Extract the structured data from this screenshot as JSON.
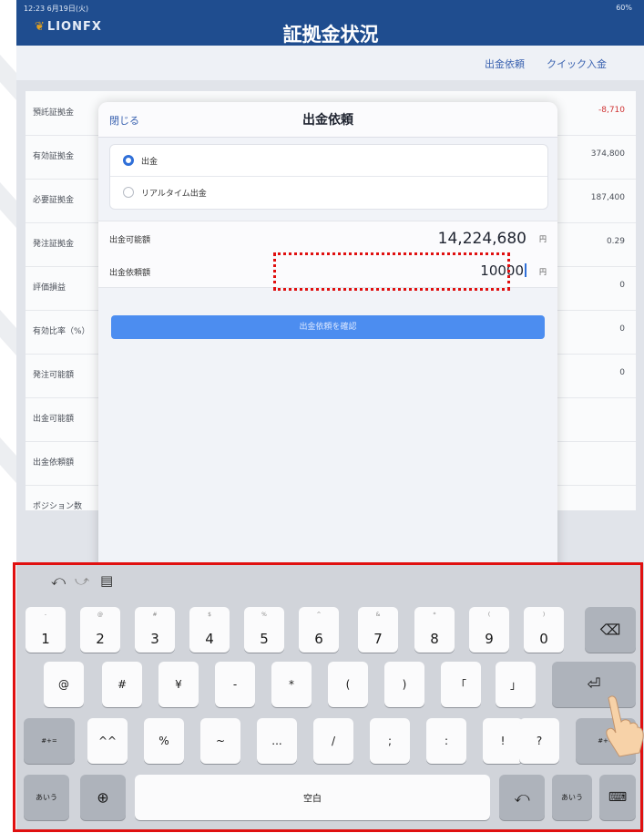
{
  "status": {
    "left": "12:23 6月19日(火)",
    "right": "60%"
  },
  "header": {
    "logo": "LIONFX",
    "title": "証拠金状況"
  },
  "subbar": {
    "withdraw_request": "出金依頼",
    "quick_deposit": "クイック入金"
  },
  "background_list": {
    "rows": [
      {
        "label": "預託証拠金",
        "value": "-8,710",
        "negative": true
      },
      {
        "label": "有効証拠金",
        "value": "374,800"
      },
      {
        "label": "必要証拠金",
        "value": "187,400"
      },
      {
        "label": "発注証拠金",
        "value": "0.29"
      },
      {
        "label": "評価損益",
        "value": "0"
      },
      {
        "label": "有効比率（%）",
        "value": "0"
      },
      {
        "label": "発注可能額",
        "value": "0"
      },
      {
        "label": "出金可能額",
        "value": ""
      },
      {
        "label": "出金依頼額",
        "value": ""
      },
      {
        "label": "ポジション数",
        "value": ""
      }
    ]
  },
  "modal": {
    "close": "閉じる",
    "title": "出金依頼",
    "options": [
      {
        "label": "出金",
        "selected": true
      },
      {
        "label": "リアルタイム出金",
        "selected": false
      }
    ],
    "available_label": "出金可能額",
    "available_value": "14,224,680",
    "request_label": "出金依頼額",
    "request_value": "10000",
    "unit": "円",
    "confirm_button": "出金依頼を確認"
  },
  "keyboard": {
    "toolbar": [
      "undo-icon",
      "redo-icon",
      "clipboard-icon"
    ],
    "row1": [
      {
        "main": "1",
        "sub": "-"
      },
      {
        "main": "2",
        "sub": "@"
      },
      {
        "main": "3",
        "sub": "#"
      },
      {
        "main": "4",
        "sub": "$"
      },
      {
        "main": "5",
        "sub": "%"
      },
      {
        "main": "6",
        "sub": "^"
      },
      {
        "main": "7",
        "sub": "&"
      },
      {
        "main": "8",
        "sub": "*"
      },
      {
        "main": "9",
        "sub": "("
      },
      {
        "main": "0",
        "sub": ")"
      }
    ],
    "row2": [
      "@",
      "#",
      "¥",
      "-",
      "*",
      "(",
      ")",
      "「",
      "」"
    ],
    "row3_left": "#+=",
    "row3": [
      "^^",
      "%",
      "~",
      "...",
      "/",
      ";",
      ":",
      "!",
      "?"
    ],
    "row3_right": "#+=",
    "row4": {
      "kana_left": "あいう",
      "space": "空白",
      "kana_right": "あいう"
    },
    "colors": {
      "key": "#fbfbfc",
      "dark_key": "#aeb3bb",
      "background": "#d1d4da"
    }
  },
  "colors": {
    "header": "#1f4d8f",
    "accent": "#3a62b0",
    "button": "#4c8df0",
    "highlight": "#e01010"
  }
}
